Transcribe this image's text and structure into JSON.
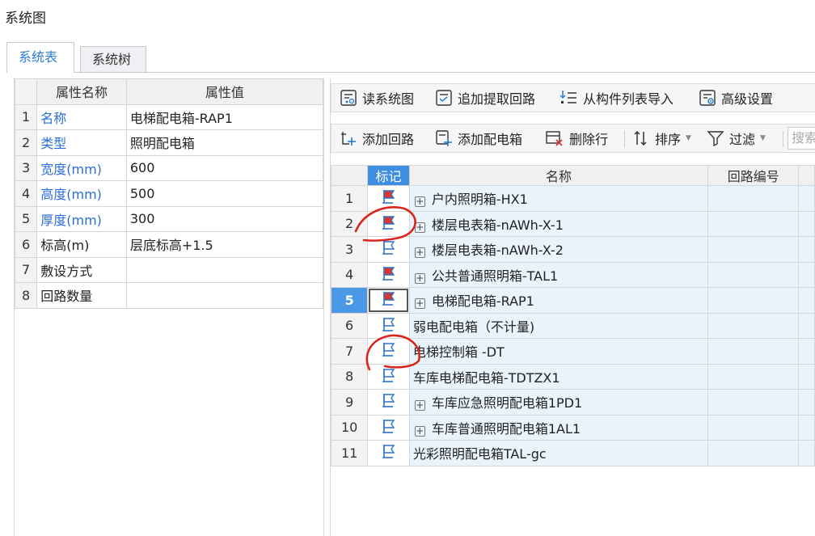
{
  "window": {
    "title": "系统图"
  },
  "tabs": [
    {
      "label": "系统表",
      "active": true
    },
    {
      "label": "系统树",
      "active": false
    }
  ],
  "properties": {
    "header": {
      "name": "属性名称",
      "value": "属性值"
    },
    "rows": [
      {
        "index": "1",
        "name": "名称",
        "value": "电梯配电箱-RAP1",
        "highlight": true
      },
      {
        "index": "2",
        "name": "类型",
        "value": "照明配电箱",
        "highlight": true
      },
      {
        "index": "3",
        "name": "宽度(mm)",
        "value": "600",
        "highlight": true
      },
      {
        "index": "4",
        "name": "高度(mm)",
        "value": "500",
        "highlight": true
      },
      {
        "index": "5",
        "name": "厚度(mm)",
        "value": "300",
        "highlight": true
      },
      {
        "index": "6",
        "name": "标高(m)",
        "value": "层底标高+1.5",
        "highlight": false
      },
      {
        "index": "7",
        "name": "敷设方式",
        "value": "",
        "highlight": false
      },
      {
        "index": "8",
        "name": "回路数量",
        "value": "",
        "highlight": false
      }
    ]
  },
  "toolbar1": {
    "read_system": "读系统图",
    "append_extract": "追加提取回路",
    "import_from_list": "从构件列表导入",
    "advanced": "高级设置"
  },
  "toolbar2": {
    "add_circuit": "添加回路",
    "add_box": "添加配电箱",
    "delete_row": "删除行",
    "sort": "排序",
    "filter": "过滤",
    "search_placeholder": "搜索"
  },
  "grid": {
    "columns": {
      "mark": "标记",
      "name": "名称",
      "code": "回路编号"
    },
    "selected_row": 5,
    "rows": [
      {
        "n": "1",
        "name": "户内照明箱-HX1",
        "expandable": true,
        "flag": "red"
      },
      {
        "n": "2",
        "name": "楼层电表箱-nAWh-X-1",
        "expandable": true,
        "flag": "red"
      },
      {
        "n": "3",
        "name": "楼层电表箱-nAWh-X-2",
        "expandable": true,
        "flag": "blue"
      },
      {
        "n": "4",
        "name": "公共普通照明箱-TAL1",
        "expandable": true,
        "flag": "red"
      },
      {
        "n": "5",
        "name": "电梯配电箱-RAP1",
        "expandable": true,
        "flag": "red"
      },
      {
        "n": "6",
        "name": "弱电配电箱（不计量)",
        "expandable": false,
        "flag": "blue"
      },
      {
        "n": "7",
        "name": "电梯控制箱 -DT",
        "expandable": false,
        "flag": "blue"
      },
      {
        "n": "8",
        "name": "车库电梯配电箱-TDTZX1",
        "expandable": false,
        "flag": "blue"
      },
      {
        "n": "9",
        "name": "车库应急照明配电箱1PD1",
        "expandable": true,
        "flag": "blue"
      },
      {
        "n": "10",
        "name": "车库普通照明配电箱1AL1",
        "expandable": true,
        "flag": "blue"
      },
      {
        "n": "11",
        "name": "光彩照明配电箱TAL-gc",
        "expandable": false,
        "flag": "blue"
      }
    ]
  },
  "colors": {
    "flag_red": "#d9352e",
    "flag_blue": "#2f74c8",
    "accent": "#2b7cd3",
    "annotation_ink": "#d8261c"
  },
  "icons": [
    "read-system-icon",
    "append-extract-icon",
    "import-list-icon",
    "advanced-settings-icon",
    "add-circuit-icon",
    "add-box-icon",
    "delete-row-icon",
    "sort-icon",
    "filter-icon",
    "flag-icon",
    "expand-plus-icon"
  ]
}
